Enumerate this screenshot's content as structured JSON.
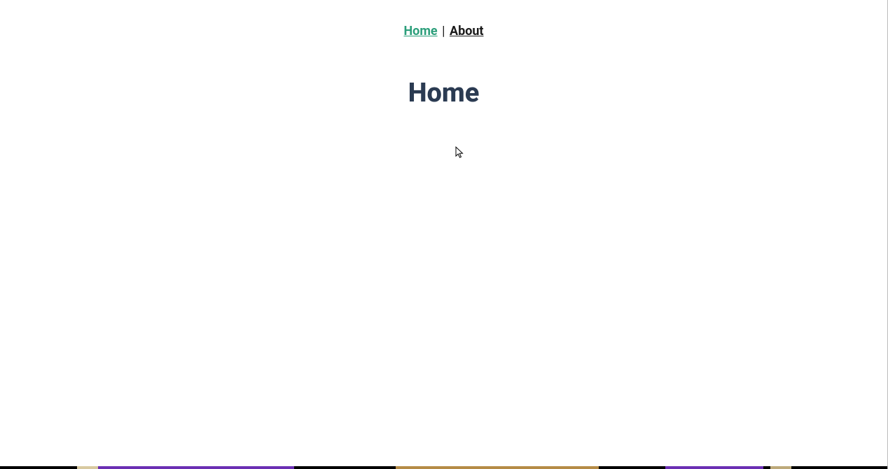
{
  "nav": {
    "home_label": "Home",
    "about_label": "About",
    "separator": " | "
  },
  "page": {
    "title": "Home"
  }
}
